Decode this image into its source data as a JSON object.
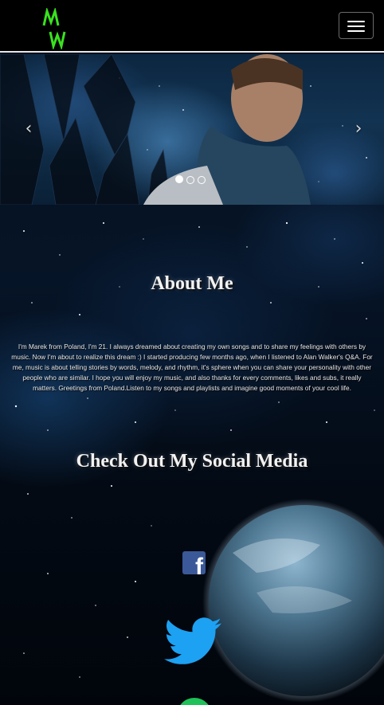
{
  "navbar": {
    "logo_text": "MW",
    "logo_color": "#39e21f",
    "menu_toggle_icon": "hamburger-icon"
  },
  "carousel": {
    "prev_icon": "chevron-left-icon",
    "next_icon": "chevron-right-icon",
    "prev_glyph": "‹",
    "next_glyph": "›",
    "slide_count": 3,
    "active_index": 0
  },
  "about": {
    "title": "About Me",
    "text": "I'm Marek from Poland, I'm 21. I always dreamed about creating my own songs and to share my feelings with others by music. Now I'm about to realize this dream :) I started producing few months ago, when I listened to Alan Walker's Q&A. For me, music is about telling stories by words, melody, and rhythm, it's sphere when you can share your personality with other people who are similar. I hope you will enjoy my music, and also thanks for every comments, likes and subs, it really matters. Greetings from Poland.Listen to my songs and playlists and imagine good moments of your cool life."
  },
  "social": {
    "title": "Check Out My Social Media",
    "links": [
      {
        "icon": "facebook-icon",
        "color": "#3b5998"
      },
      {
        "icon": "twitter-icon",
        "color": "#1da1f2"
      },
      {
        "icon": "spotify-icon",
        "color": "#1fc15a"
      }
    ]
  }
}
